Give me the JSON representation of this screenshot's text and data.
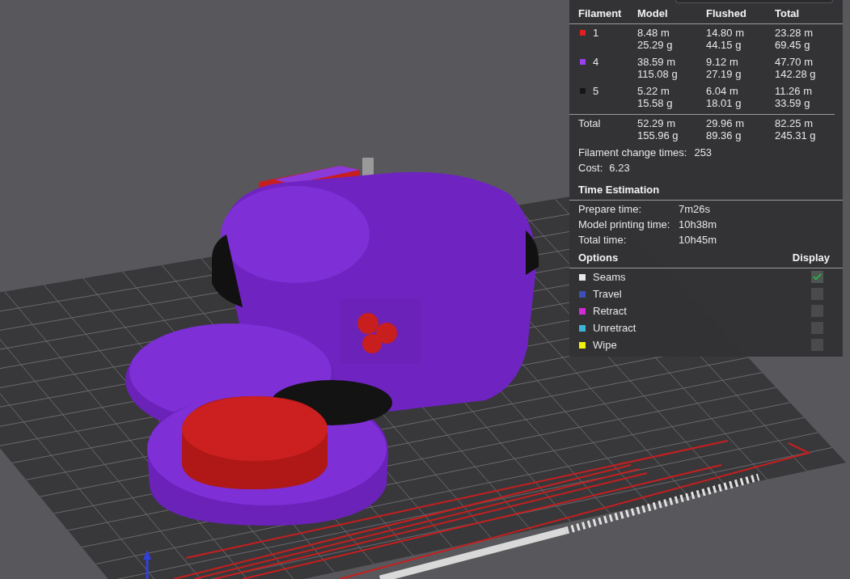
{
  "filament_table": {
    "columns": [
      "Filament",
      "Model",
      "Flushed",
      "Total"
    ],
    "rows": [
      {
        "filament": "1",
        "color": "#e02020",
        "model": {
          "length": "8.48 m",
          "weight": "25.29 g"
        },
        "flushed": {
          "length": "14.80 m",
          "weight": "44.15 g"
        },
        "total": {
          "length": "23.28 m",
          "weight": "69.45 g"
        }
      },
      {
        "filament": "4",
        "color": "#9b3ff0",
        "model": {
          "length": "38.59 m",
          "weight": "115.08 g"
        },
        "flushed": {
          "length": "9.12 m",
          "weight": "27.19 g"
        },
        "total": {
          "length": "47.70 m",
          "weight": "142.28 g"
        }
      },
      {
        "filament": "5",
        "color": "#161616",
        "model": {
          "length": "5.22 m",
          "weight": "15.58 g"
        },
        "flushed": {
          "length": "6.04 m",
          "weight": "18.01 g"
        },
        "total": {
          "length": "11.26 m",
          "weight": "33.59 g"
        }
      }
    ],
    "total": {
      "label": "Total",
      "model": {
        "length": "52.29 m",
        "weight": "155.96 g"
      },
      "flushed": {
        "length": "29.96 m",
        "weight": "89.36 g"
      },
      "total": {
        "length": "82.25 m",
        "weight": "245.31 g"
      }
    }
  },
  "filament_change_times": {
    "label": "Filament change times:",
    "value": "253"
  },
  "cost": {
    "label": "Cost:",
    "value": "6.23"
  },
  "time_estimation": {
    "title": "Time Estimation",
    "rows": [
      {
        "label": "Prepare time:",
        "value": "7m26s"
      },
      {
        "label": "Model printing time:",
        "value": "10h38m"
      },
      {
        "label": "Total time:",
        "value": "10h45m"
      }
    ]
  },
  "options": {
    "title": "Options",
    "display_header": "Display",
    "items": [
      {
        "label": "Seams",
        "color": "#e8e8e8",
        "checked": true
      },
      {
        "label": "Travel",
        "color": "#3b4fb8",
        "checked": false
      },
      {
        "label": "Retract",
        "color": "#d42bd8",
        "checked": false
      },
      {
        "label": "Unretract",
        "color": "#3bb4d6",
        "checked": false
      },
      {
        "label": "Wipe",
        "color": "#f2f20a",
        "checked": false
      }
    ]
  }
}
